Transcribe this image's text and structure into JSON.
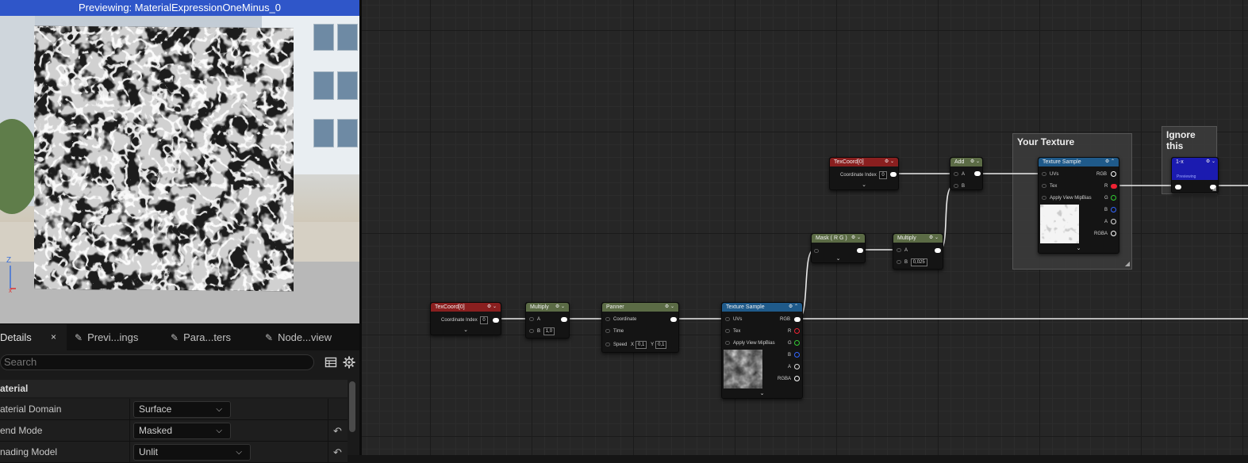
{
  "viewport": {
    "title": "Previewing: MaterialExpressionOneMinus_0"
  },
  "details": {
    "tabs": [
      {
        "label": "Details"
      },
      {
        "label": "Previ...ings"
      },
      {
        "label": "Para...ters"
      },
      {
        "label": "Node...view"
      }
    ],
    "close_glyph": "×",
    "search_placeholder": "Search",
    "category": "aterial",
    "properties": [
      {
        "label": "aterial Domain",
        "value": "Surface"
      },
      {
        "label": "end Mode",
        "value": "Masked"
      },
      {
        "label": "nading Model",
        "value": "Unlit"
      }
    ]
  },
  "graph": {
    "comments": [
      {
        "title": "Your Texture"
      },
      {
        "title": "Ignore this"
      }
    ],
    "nodes": {
      "texcoord_left": {
        "title": "TexCoord[0]",
        "coordinate_label": "Coordinate Index",
        "coordinate_value": "0"
      },
      "multiply_left": {
        "title": "Multiply",
        "a": "A",
        "b": "B",
        "b_value": "1,0"
      },
      "panner": {
        "title": "Panner",
        "coordinate": "Coordinate",
        "time": "Time",
        "speed": "Speed",
        "speed_x_label": "X",
        "speed_x": "0,1",
        "speed_y_label": "Y",
        "speed_y": "0,1"
      },
      "texsample_left": {
        "title": "Texture Sample",
        "uvs": "UVs",
        "tex": "Tex",
        "mip": "Apply View MipBias",
        "rgb": "RGB",
        "r": "R",
        "g": "G",
        "b": "B",
        "a": "A",
        "rgba": "RGBA"
      },
      "mask": {
        "title": "Mask ( R G )"
      },
      "texcoord_top": {
        "title": "TexCoord[0]",
        "coordinate_label": "Coordinate Index",
        "coordinate_value": "0"
      },
      "multiply_top": {
        "title": "Multiply",
        "a": "A",
        "b": "B",
        "b_value": "0,025"
      },
      "add": {
        "title": "Add",
        "a": "A",
        "b": "B"
      },
      "texsample_right": {
        "title": "Texture Sample",
        "uvs": "UVs",
        "tex": "Tex",
        "mip": "Apply View MipBias",
        "rgb": "RGB",
        "r": "R",
        "g": "G",
        "b": "B",
        "a": "A",
        "rgba": "RGBA"
      },
      "oneminus": {
        "title": "1-x",
        "sub": "Previewing"
      }
    }
  },
  "colors": {
    "texcoord_header": "#8a1f1f",
    "math_header": "#5b6b45",
    "panner_header": "#5b6b45",
    "texture_header": "#1f5a8a",
    "oneminus_header": "#1b1bb0",
    "preview_bar": "#2f56c9"
  }
}
